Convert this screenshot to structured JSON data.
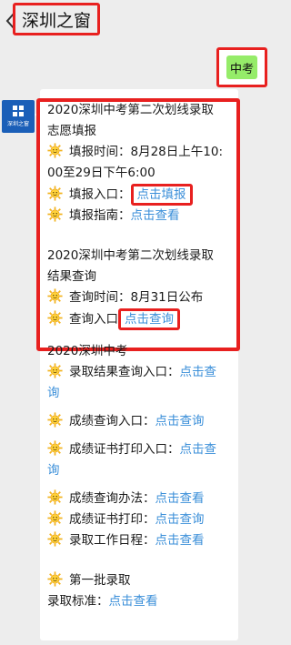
{
  "header": {
    "title": "深圳之窗"
  },
  "outgoing": {
    "text": "中考"
  },
  "avatar": {
    "label": "深圳之窗"
  },
  "message": {
    "section1_title_l1": "2020深圳中考第二次划线录取",
    "section1_title_l2": "志愿填报",
    "fill_time_l1": "填报时间：8月28日上午10:",
    "fill_time_l2": "00至29日下午6:00",
    "fill_entry_label": "填报入口：",
    "fill_entry_link": "点击填报",
    "fill_guide_label": "填报指南：",
    "fill_guide_link": "点击查看",
    "section2_title_l1": "2020深圳中考第二次划线录取",
    "section2_title_l2": "结果查询",
    "query_time": "查询时间：8月31日公布",
    "query_entry_label": "查询入口",
    "query_entry_link": "点击查询",
    "section3_title": "2020深圳中考",
    "admission_query_label": "录取结果查询入口：",
    "admission_query_link_l1": "点击查",
    "admission_query_link_l2": "询",
    "score_query_label": "成绩查询入口：",
    "score_query_link": "点击查询",
    "cert_print_entry_label": "成绩证书打印入口：",
    "cert_print_entry_link_l1": "点击查",
    "cert_print_entry_link_l2": "询",
    "score_method_label": "成绩查询办法：",
    "score_method_link": "点击查看",
    "cert_print_label": "成绩证书打印：",
    "cert_print_link": "点击查询",
    "schedule_label": "录取工作日程：",
    "schedule_link": "点击查看",
    "batch1_label": "第一批录取",
    "standard_label": "录取标准：",
    "standard_link": "点击查看"
  },
  "colors": {
    "accent_red": "#e8201f",
    "link_blue": "#3b8fd9",
    "bubble_green": "#95ec69",
    "avatar_blue": "#1b5fb8"
  },
  "icons": {
    "back": "chevron-left-icon",
    "bullet": "sun-emoji-icon"
  }
}
